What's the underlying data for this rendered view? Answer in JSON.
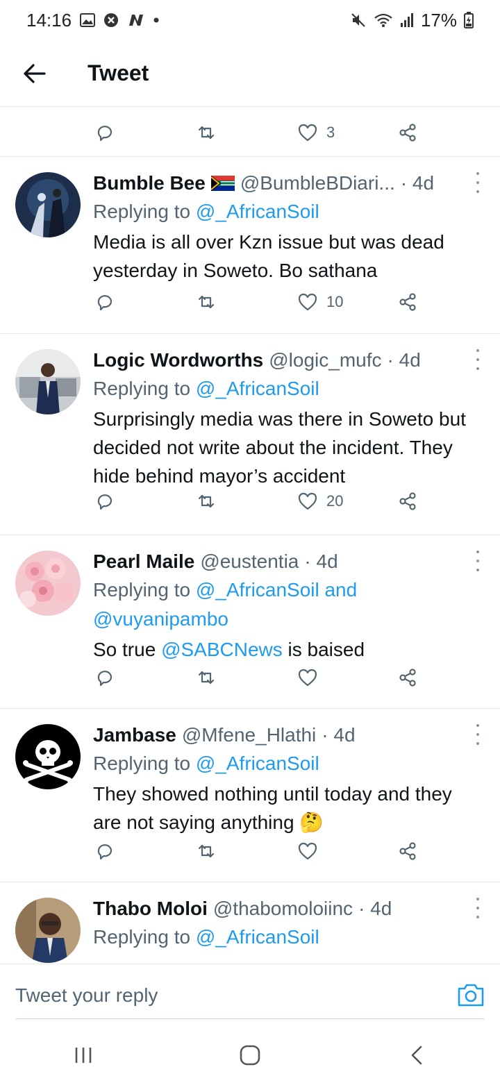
{
  "status_bar": {
    "time": "14:16",
    "battery": "17%",
    "icons_left": [
      "gallery-icon",
      "shield-icon",
      "n-app-icon"
    ],
    "icons_right": [
      "mute-icon",
      "wifi-icon",
      "signal-icon",
      "battery-icon"
    ]
  },
  "header": {
    "title": "Tweet"
  },
  "top_actions": {
    "likes": "3"
  },
  "tweets": [
    {
      "name": "Bumble Bee",
      "handle": "@BumbleBDiari...",
      "time": "· 4d",
      "replying_prefix": "Replying to ",
      "replying_to": "@_AfricanSoil",
      "text": "Media is all over Kzn issue but was dead yesterday in Soweto. Bo sathana",
      "likes": "10"
    },
    {
      "name": "Logic Wordworths",
      "handle": "@logic_mufc",
      "time": "· 4d",
      "replying_prefix": "Replying to ",
      "replying_to": "@_AfricanSoil",
      "text": "Surprisingly media was there in Soweto but decided not write about the incident. They hide behind mayor’s accident",
      "likes": "20"
    },
    {
      "name": "Pearl Maile",
      "handle": "@eustentia",
      "time": "· 4d",
      "replying_prefix": "Replying to ",
      "replying_to": "@_AfricanSoil and",
      "replying_to_2": "@vuyanipambo",
      "text_before": "So true ",
      "text_mention": "@SABCNews",
      "text_after": " is baised",
      "likes": ""
    },
    {
      "name": "Jambase",
      "handle": "@Mfene_Hlathi",
      "time": "· 4d",
      "replying_prefix": "Replying to ",
      "replying_to": "@_AfricanSoil",
      "text": "They showed nothing until today and they are not saying anything 🤔",
      "likes": ""
    },
    {
      "name": "Thabo Moloi",
      "handle": "@thabomoloiinc",
      "time": "· 4d",
      "replying_prefix": "Replying to ",
      "replying_to": "@_AfricanSoil",
      "text": ""
    }
  ],
  "reply_bar": {
    "placeholder": "Tweet your reply"
  },
  "colors": {
    "accent": "#1d9bf0",
    "secondary_text": "#536471",
    "divider": "#e6ecf0"
  }
}
